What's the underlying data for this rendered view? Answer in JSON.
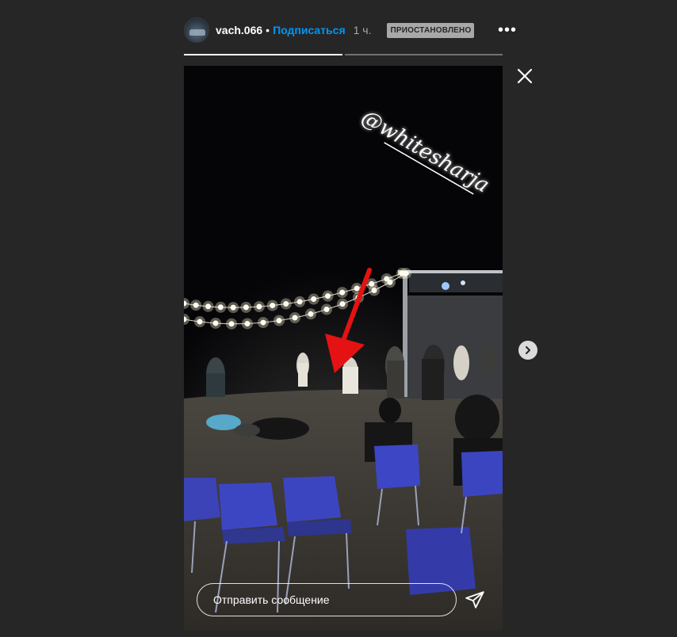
{
  "header": {
    "username": "vach.066",
    "separator": "•",
    "follow_label": "Подписаться",
    "time": "1 ч.",
    "status_badge": "ПРИОСТАНОВЛЕНО",
    "more_icon": "more-horizontal-icon"
  },
  "progress": {
    "segments": [
      {
        "fill": 1.0
      },
      {
        "fill": 0.0
      }
    ]
  },
  "story": {
    "caption_sticker": "@whitesharja",
    "arrow_color": "#e41212"
  },
  "reply": {
    "placeholder": "Отправить сообщение"
  },
  "icons": {
    "close": "close-icon",
    "next": "chevron-right-icon",
    "send": "send-icon"
  },
  "colors": {
    "background": "#262626",
    "accent": "#0095f6",
    "badge_bg": "#a8a8a8"
  }
}
